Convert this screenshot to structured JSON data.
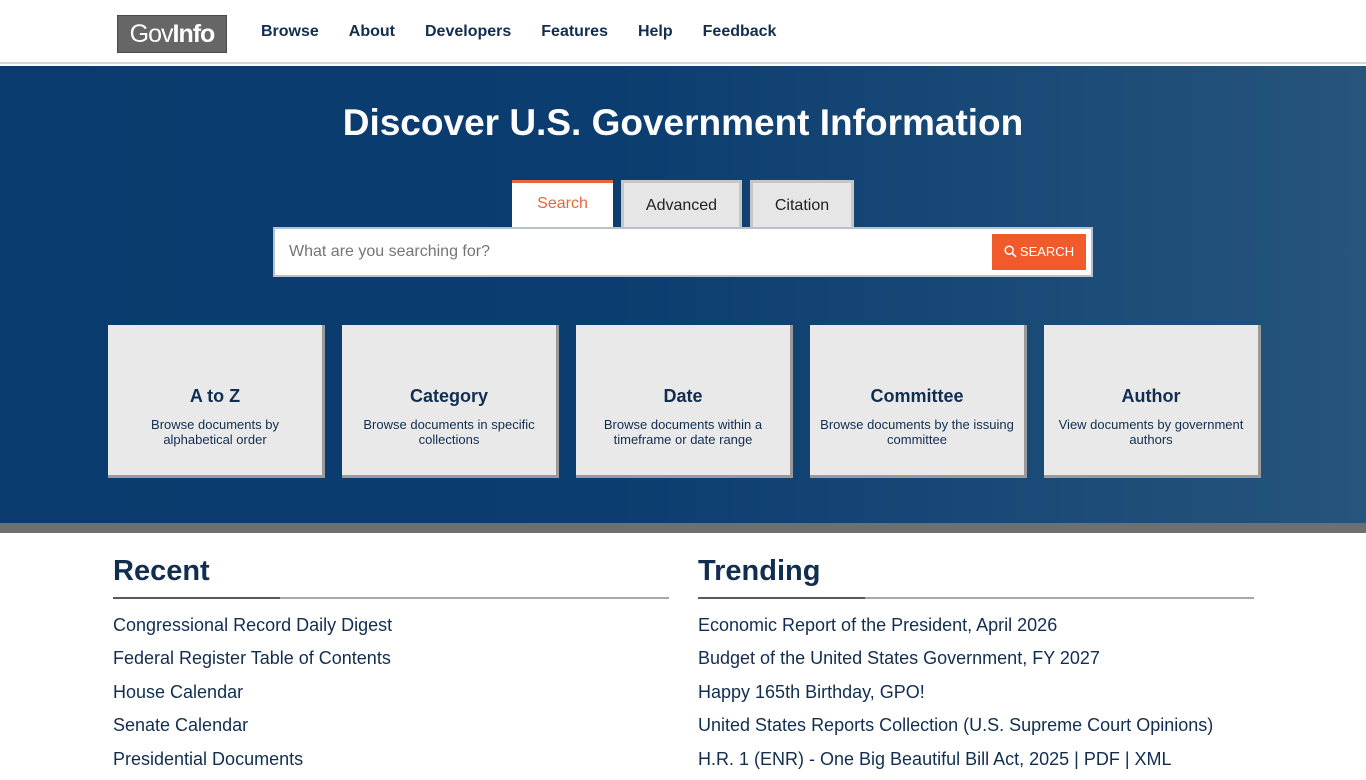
{
  "logo": {
    "gov": "Gov",
    "info": "Info"
  },
  "nav": [
    "Browse",
    "About",
    "Developers",
    "Features",
    "Help",
    "Feedback"
  ],
  "hero": {
    "title": "Discover U.S. Government Information",
    "tabs": [
      "Search",
      "Advanced",
      "Citation"
    ],
    "active_tab": "Search",
    "search": {
      "placeholder": "What are you searching for?",
      "button_label": "SEARCH"
    }
  },
  "cards": [
    {
      "title": "A to Z",
      "desc": "Browse documents by alphabetical order"
    },
    {
      "title": "Category",
      "desc": "Browse documents in specific collections"
    },
    {
      "title": "Date",
      "desc": "Browse documents within a timeframe or date range"
    },
    {
      "title": "Committee",
      "desc": "Browse documents by the issuing committee"
    },
    {
      "title": "Author",
      "desc": "View documents by government authors"
    }
  ],
  "recent": {
    "title": "Recent",
    "items": [
      "Congressional Record Daily Digest",
      "Federal Register Table of Contents",
      "House Calendar",
      "Senate Calendar",
      "Presidential Documents"
    ]
  },
  "trending": {
    "title": "Trending",
    "items": [
      "Economic Report of the President, April 2026",
      "Budget of the United States Government, FY 2027",
      "Happy 165th Birthday, GPO!",
      "United States Reports Collection (U.S. Supreme Court Opinions)",
      "H.R. 1 (ENR) - One Big Beautiful Bill Act, 2025 | PDF | XML"
    ]
  },
  "colors": {
    "accent": "#f15b2c",
    "navy": "#112e51",
    "hero": "#0b3d70"
  },
  "icons": {
    "search_button": "search-icon"
  }
}
